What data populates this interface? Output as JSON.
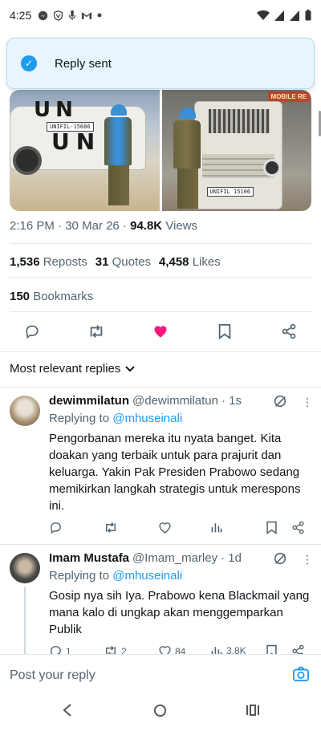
{
  "status_bar": {
    "time": "4:25",
    "left_icons": [
      "messenger-icon",
      "shield-v-icon",
      "mic-icon",
      "gmail-icon",
      "dot-icon"
    ],
    "right_icons": [
      "wifi-icon",
      "signal-icon",
      "signal-icon",
      "battery-icon"
    ]
  },
  "toast": {
    "message": "Reply sent"
  },
  "media": {
    "left_vehicle_text": "UN",
    "left_plate": "UNIFIL-15686",
    "right_sign": "MOBILE RE",
    "right_plate": "UNIFIL 15106"
  },
  "tweet": {
    "time": "2:16 PM",
    "date": "30 Mar 26",
    "views_count": "94.8K",
    "views_label": "Views",
    "reposts_count": "1,536",
    "reposts_label": "Reposts",
    "quotes_count": "31",
    "quotes_label": "Quotes",
    "likes_count": "4,458",
    "likes_label": "Likes",
    "bookmarks_count": "150",
    "bookmarks_label": "Bookmarks"
  },
  "colors": {
    "accent": "#1d9bf0",
    "like": "#f91880",
    "muted": "#536471"
  },
  "sort": {
    "label": "Most relevant replies"
  },
  "replies": [
    {
      "name": "dewimmilatun",
      "handle": "@dewimmilatun",
      "time": "· 1s",
      "replying_prefix": "Replying to",
      "replying_to": "@mhuseinali",
      "text": "Pengorbanan mereka itu nyata banget. Kita doakan yang terbaik untuk para prajurit dan keluarga. Yakin Pak Presiden Prabowo sedang memikirkan langkah strategis untuk merespons ini."
    },
    {
      "name": "Imam Mustafa",
      "handle": "@Imam_marley",
      "time": "· 1d",
      "replying_prefix": "Replying to",
      "replying_to": "@mhuseinali",
      "text": "Gosip nya sih Iya. Prabowo kena Blackmail yang mana kalo di ungkap akan menggemparkan Publik",
      "reply_count": "1",
      "repost_count": "2",
      "like_count": "84",
      "view_count": "3.8K"
    }
  ],
  "composer": {
    "placeholder": "Post your reply"
  }
}
